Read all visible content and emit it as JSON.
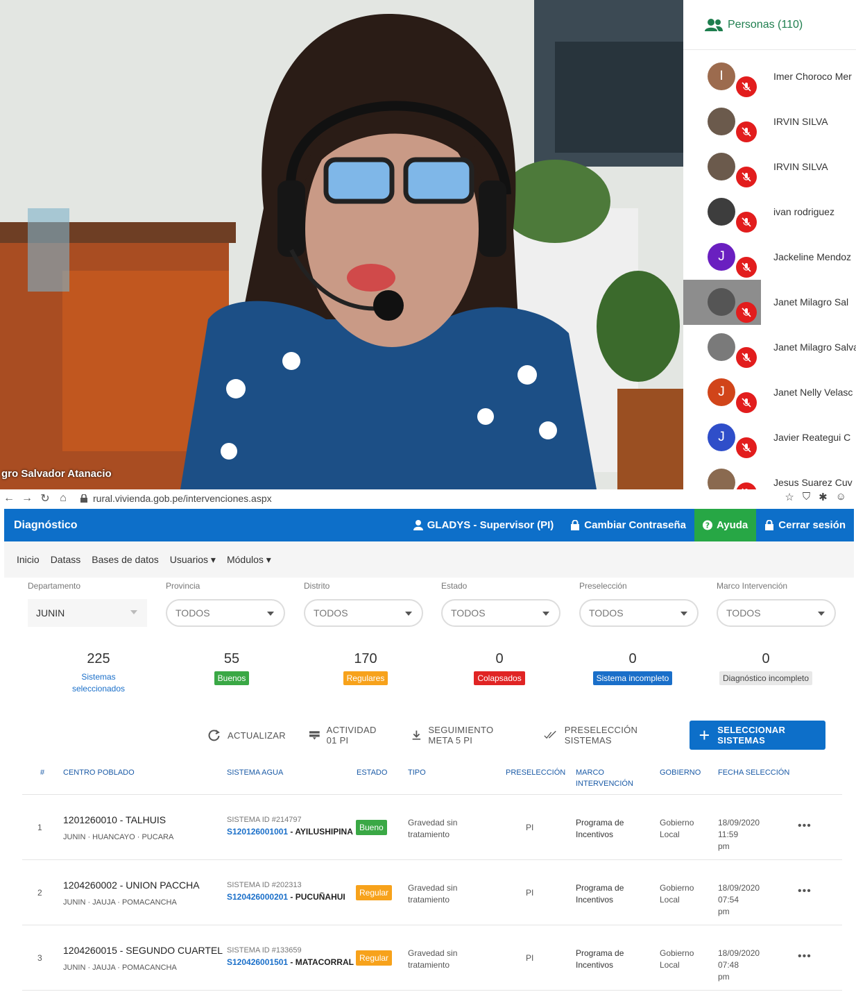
{
  "video": {
    "speaker_name": "gro Salvador Atanacio",
    "people_title": "Personas (110)",
    "participants": [
      {
        "name": "Imer Choroco Mer",
        "initial": "I",
        "color": "#9c6b4e"
      },
      {
        "name": "IRVIN SILVA",
        "initial": "",
        "color": "#6b5a4c"
      },
      {
        "name": "IRVIN SILVA",
        "initial": "",
        "color": "#6b5a4c"
      },
      {
        "name": "ivan rodriguez",
        "initial": "",
        "color": "#3d3d3d"
      },
      {
        "name": "Jackeline Mendoz",
        "initial": "J",
        "color": "#6a1fc0"
      },
      {
        "name": "Janet Milagro Sal",
        "initial": "",
        "color": "#555555"
      },
      {
        "name": "Janet Milagro Salva",
        "initial": "",
        "color": "#7a7a7a"
      },
      {
        "name": "Janet Nelly Velasc",
        "initial": "J",
        "color": "#d1451a"
      },
      {
        "name": "Javier Reategui C",
        "initial": "J",
        "color": "#2f4ec9"
      },
      {
        "name": "Jesus Suarez Cuv",
        "initial": "",
        "color": "#8a6a50"
      }
    ]
  },
  "browser": {
    "url": "rural.vivienda.gob.pe/intervenciones.aspx"
  },
  "header": {
    "brand": "Diagnóstico",
    "user": "GLADYS - Supervisor (PI)",
    "change_password": "Cambiar Contraseña",
    "help": "Ayuda",
    "logout": "Cerrar sesión"
  },
  "menu": [
    "Inicio",
    "Datass",
    "Bases de datos",
    "Usuarios ▾",
    "Módulos ▾"
  ],
  "filters": [
    {
      "label": "Departamento",
      "value": "JUNIN"
    },
    {
      "label": "Provincia",
      "value": "TODOS"
    },
    {
      "label": "Distrito",
      "value": "TODOS"
    },
    {
      "label": "Estado",
      "value": "TODOS"
    },
    {
      "label": "Preselección",
      "value": "TODOS"
    },
    {
      "label": "Marco Intervención",
      "value": "TODOS"
    }
  ],
  "stats": [
    {
      "value": "225",
      "label": "Sistemas seleccionados",
      "color": "#1a6fc9"
    },
    {
      "value": "55",
      "label": "Buenos",
      "color": "#3aa845"
    },
    {
      "value": "170",
      "label": "Regulares",
      "color": "#f7a21b"
    },
    {
      "value": "0",
      "label": "Colapsados",
      "color": "#e02424"
    },
    {
      "value": "0",
      "label": "Sistema incompleto",
      "color": "#1a6fc9"
    },
    {
      "value": "0",
      "label": "Diagnóstico incompleto",
      "color": "#e8e8e8"
    }
  ],
  "toolbar": {
    "refresh": "ACTUALIZAR",
    "activity": "ACTIVIDAD 01 PI",
    "download": "SEGUIMIENTO META 5 PI",
    "preselect": "PRESELECCIÓN SISTEMAS",
    "select": "SELECCIONAR SISTEMAS"
  },
  "table": {
    "headers": {
      "idx": "#",
      "centro": "CENTRO POBLADO",
      "sistema": "SISTEMA AGUA",
      "estado": "ESTADO",
      "tipo": "TIPO",
      "pre": "PRESELECCIÓN",
      "marco1": "MARCO",
      "marco2": "INTERVENCIÓN",
      "gobierno": "GOBIERNO",
      "fecha": "FECHA SELECCIÓN"
    },
    "rows": [
      {
        "idx": "1",
        "centro": "1201260010 - TALHUIS",
        "ubic": "JUNIN · HUANCAYO · PUCARA",
        "sid": "SISTEMA ID #214797",
        "code": "S120126001001",
        "sname": " - AYILUSHIPINA",
        "estado": "Bueno",
        "estado_color": "#3aa845",
        "tipo1": "Gravedad sin",
        "tipo2": "tratamiento",
        "pre": "PI",
        "marco1": "Programa de",
        "marco2": "Incentivos",
        "gob1": "Gobierno",
        "gob2": "Local",
        "fecha1": "18/09/2020 11:59",
        "fecha2": "pm",
        "more": "•••"
      },
      {
        "idx": "2",
        "centro": "1204260002 - UNION PACCHA",
        "ubic": "JUNIN · JAUJA · POMACANCHA",
        "sid": "SISTEMA ID #202313",
        "code": "S120426000201",
        "sname": " - PUCUÑAHUI",
        "estado": "Regular",
        "estado_color": "#f7a21b",
        "tipo1": "Gravedad sin",
        "tipo2": "tratamiento",
        "pre": "PI",
        "marco1": "Programa de",
        "marco2": "Incentivos",
        "gob1": "Gobierno",
        "gob2": "Local",
        "fecha1": "18/09/2020 07:54",
        "fecha2": "pm",
        "more": "•••"
      },
      {
        "idx": "3",
        "centro": "1204260015 - SEGUNDO CUARTEL",
        "ubic": "JUNIN · JAUJA · POMACANCHA",
        "sid": "SISTEMA ID #133659",
        "code": "S120426001501",
        "sname": " - MATACORRAL",
        "estado": "Regular",
        "estado_color": "#f7a21b",
        "tipo1": "Gravedad sin",
        "tipo2": "tratamiento",
        "pre": "PI",
        "marco1": "Programa de",
        "marco2": "Incentivos",
        "gob1": "Gobierno",
        "gob2": "Local",
        "fecha1": "18/09/2020 07:48",
        "fecha2": "pm",
        "more": "•••"
      }
    ]
  }
}
